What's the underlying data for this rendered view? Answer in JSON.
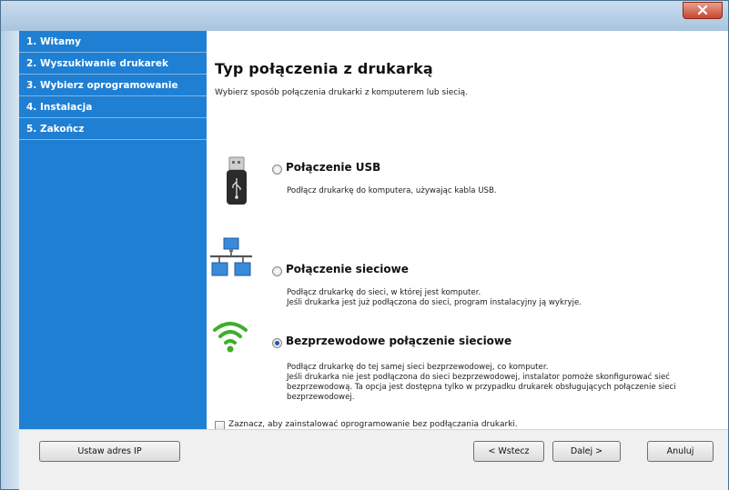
{
  "steps": [
    "1. Witamy",
    "2. Wyszukiwanie drukarek",
    "3. Wybierz oprogramowanie",
    "4. Instalacja",
    "5. Zakończ"
  ],
  "main": {
    "title": "Typ połączenia z drukarką",
    "subtitle": "Wybierz sposób połączenia drukarki z komputerem lub siecią."
  },
  "options": [
    {
      "label": "Połączenie USB",
      "desc": [
        "Podłącz drukarkę do komputera, używając kabla USB."
      ],
      "selected": false,
      "icon": "usb-icon"
    },
    {
      "label": "Połączenie sieciowe",
      "desc": [
        "Podłącz drukarkę do sieci, w której jest komputer.",
        "Jeśli drukarka jest już podłączona do sieci, program instalacyjny ją wykryje."
      ],
      "selected": false,
      "icon": "network-icon"
    },
    {
      "label": "Bezprzewodowe połączenie sieciowe",
      "desc": [
        "Podłącz drukarkę do tej samej sieci bezprzewodowej, co komputer.",
        "Jeśli drukarka nie jest podłączona do sieci bezprzewodowej, instalator pomoże skonfigurować sieć bezprzewodową. Ta opcja jest dostępna tylko w przypadku drukarek obsługujących połączenie sieci bezprzewodowej."
      ],
      "selected": true,
      "icon": "wifi-icon"
    }
  ],
  "checkbox": {
    "label": "Zaznacz, aby zainstalować oprogramowanie bez podłączania drukarki.",
    "checked": false
  },
  "buttons": {
    "set_ip": "Ustaw adres IP",
    "back": "< Wstecz",
    "next": "Dalej >",
    "cancel": "Anuluj"
  },
  "colors": {
    "sidebar": "#1f7fd3",
    "close": "#c9452e",
    "wifi": "#3fae2a"
  }
}
